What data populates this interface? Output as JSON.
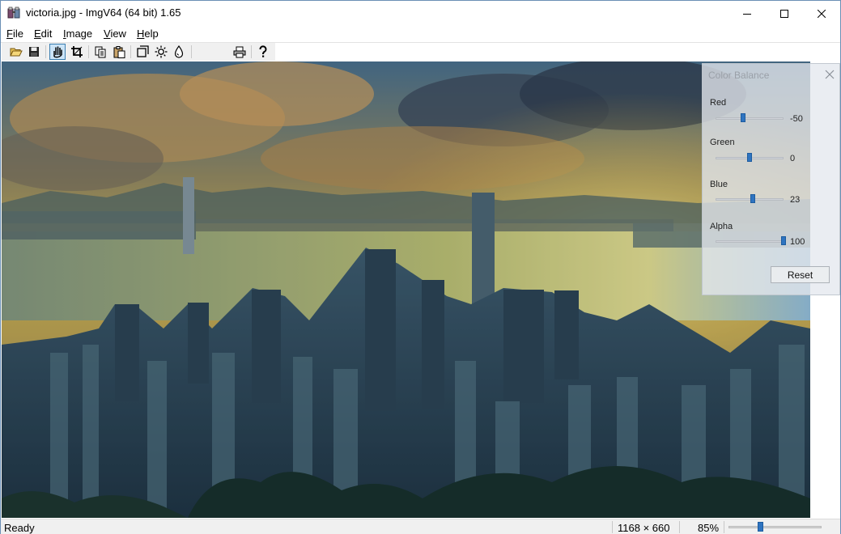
{
  "window": {
    "title": "victoria.jpg - ImgV64 (64 bit) 1.65"
  },
  "menu": {
    "items": [
      {
        "label": "File",
        "accel": "F",
        "rest": "ile"
      },
      {
        "label": "Edit",
        "accel": "E",
        "rest": "dit"
      },
      {
        "label": "Image",
        "accel": "I",
        "rest": "mage"
      },
      {
        "label": "View",
        "accel": "V",
        "rest": "iew"
      },
      {
        "label": "Help",
        "accel": "H",
        "rest": "elp"
      }
    ]
  },
  "toolbar": {
    "buttons": [
      {
        "icon": "open-folder-icon",
        "active": false
      },
      {
        "icon": "save-icon",
        "active": false
      },
      {
        "icon": "pan-hand-icon",
        "active": true
      },
      {
        "icon": "crop-icon",
        "active": false
      },
      {
        "icon": "copy-icon",
        "active": false
      },
      {
        "icon": "paste-icon",
        "active": false
      },
      {
        "icon": "resize-icon",
        "active": false
      },
      {
        "icon": "brightness-icon",
        "active": false
      },
      {
        "icon": "color-drop-icon",
        "active": false
      },
      {
        "icon": "print-icon",
        "active": false
      },
      {
        "icon": "help-icon",
        "active": false
      }
    ]
  },
  "color_balance": {
    "title": "Color Balance",
    "sliders": [
      {
        "label": "Red",
        "value": "-50",
        "level": -50,
        "min": -255,
        "max": 255
      },
      {
        "label": "Green",
        "value": "0",
        "level": 0,
        "min": -255,
        "max": 255
      },
      {
        "label": "Blue",
        "value": "23",
        "level": 23,
        "min": -255,
        "max": 255
      },
      {
        "label": "Alpha",
        "value": "100",
        "level": 100,
        "min": 0,
        "max": 100
      }
    ],
    "reset_label": "Reset"
  },
  "status": {
    "text": "Ready",
    "dimensions": "1168 × 660",
    "zoom": "85%",
    "zoom_level": 85
  },
  "colors": {
    "accent": "#2f74c0",
    "toolbar_active_bg": "#cce4f7",
    "toolbar_active_border": "#3c7fb1"
  }
}
